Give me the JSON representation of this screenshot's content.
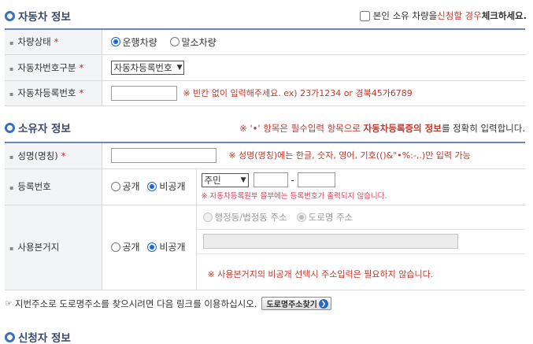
{
  "vehicle_section": {
    "title": "자동차 정보",
    "owner_check_prefix": "본인 소유 차량을 ",
    "owner_check_emph": "신청할 경우",
    "owner_check_suffix": " 체크하세요."
  },
  "vehicle_fields": {
    "status_label": "차량상태",
    "status_options": [
      "운행차량",
      "말소차량"
    ],
    "status_selected": "운행차량",
    "number_type_label": "자동차번호구분",
    "number_type_value": "자동차등록번호",
    "reg_number_label": "자동차등록번호",
    "reg_number_hint": "※ 빈칸 없이 입력해주세요. ex) 23가1234 or 경북45가6789",
    "required_mark": "*"
  },
  "owner_section": {
    "title": "소유자 정보",
    "notice_prefix": "※ '•' 항목은 필수입력 항목으로 ",
    "notice_emph": "자동차등록증의 정보",
    "notice_suffix": "를 정확히 입력합니다."
  },
  "owner_fields": {
    "name_label": "성명(명칭)",
    "name_hint": "※ 성명(명칭)에는 한글, 숫자, 영어, 기호(()&\"•%:-,.)만 입력 가능",
    "reg_no_label": "등록번호",
    "visibility_options": [
      "공개",
      "비공개"
    ],
    "visibility_selected": "비공개",
    "id_type_value": "주민",
    "dash": "-",
    "reg_no_hint": "※ 자동차등록원부 을부에는 등록번호가 출력되지 않습니다.",
    "base_address_label": "사용본거지",
    "address_type_options": [
      "행정동/법정동 주소",
      "도로명 주소"
    ],
    "address_type_selected": "도로명 주소",
    "address_hint": "※ 사용본거지의 비공개 선택시 주소입력은 필요하지 않습니다."
  },
  "address_link": {
    "text": "지번주소로 도로명주소를 찾으시려면 다음 링크를 이용하십시오.",
    "button_label": "도로명주소찾기"
  },
  "applicant_section": {
    "title": "신청자 정보"
  },
  "colors": {
    "accent": "#3d6fbf",
    "required": "#d02b2b",
    "hint": "#c0392b",
    "label_bg": "#f3f4f6"
  }
}
